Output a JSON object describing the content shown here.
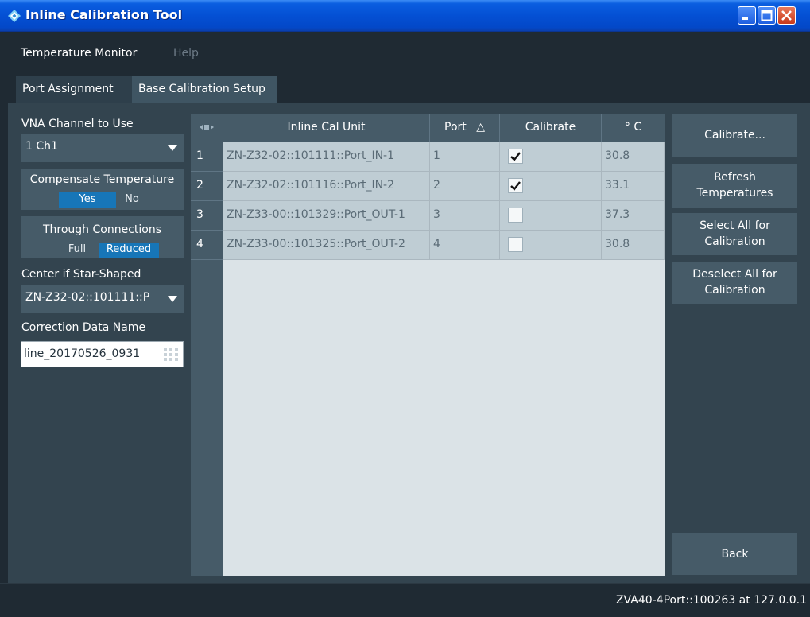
{
  "window": {
    "title": "Inline Calibration Tool"
  },
  "menu": {
    "items": [
      "Temperature Monitor",
      "Help"
    ]
  },
  "tabs": [
    "Port Assignment",
    "Base Calibration Setup"
  ],
  "left": {
    "vna_channel_label": "VNA Channel to Use",
    "vna_channel_value": "1 Ch1",
    "compensate_label": "Compensate Temperature",
    "compensate_options": [
      "Yes",
      "No"
    ],
    "compensate_selected": "Yes",
    "through_label": "Through Connections",
    "through_options": [
      "Full",
      "Reduced"
    ],
    "through_selected": "Reduced",
    "center_label": "Center if Star-Shaped",
    "center_value": "ZN-Z32-02::101111::P",
    "correction_label": "Correction Data Name",
    "correction_value": "line_20170526_0931"
  },
  "table": {
    "headers": {
      "unit": "Inline Cal Unit",
      "port": "Port",
      "calibrate": "Calibrate",
      "temp": "° C"
    },
    "sort_indicator": "△",
    "rows": [
      {
        "num": "1",
        "unit": "ZN-Z32-02::101111::Port_IN-1",
        "port": "1",
        "calibrate": true,
        "temp": "30.8"
      },
      {
        "num": "2",
        "unit": "ZN-Z32-02::101116::Port_IN-2",
        "port": "2",
        "calibrate": true,
        "temp": "33.1"
      },
      {
        "num": "3",
        "unit": "ZN-Z33-00::101329::Port_OUT-1",
        "port": "3",
        "calibrate": false,
        "temp": "37.3"
      },
      {
        "num": "4",
        "unit": "ZN-Z33-00::101325::Port_OUT-2",
        "port": "4",
        "calibrate": false,
        "temp": "30.8"
      }
    ]
  },
  "buttons": {
    "calibrate": "Calibrate...",
    "refresh_l1": "Refresh",
    "refresh_l2": "Temperatures",
    "select_l1": "Select All for",
    "select_l2": "Calibration",
    "deselect_l1": "Deselect All for",
    "deselect_l2": "Calibration",
    "back": "Back"
  },
  "status": {
    "text": "ZVA40-4Port::100263 at 127.0.0.1"
  },
  "colors": {
    "titlebar": "#0450d4",
    "background": "#1f2a33",
    "panel": "#33444f",
    "control": "#465b68",
    "accent": "#1776b8"
  },
  "icons": [
    "app-diamond-icon",
    "minimize-icon",
    "maximize-icon",
    "close-icon",
    "dropdown-caret-icon",
    "keyboard-icon",
    "checkmark-icon",
    "column-resize-icon",
    "sort-ascending-icon"
  ]
}
